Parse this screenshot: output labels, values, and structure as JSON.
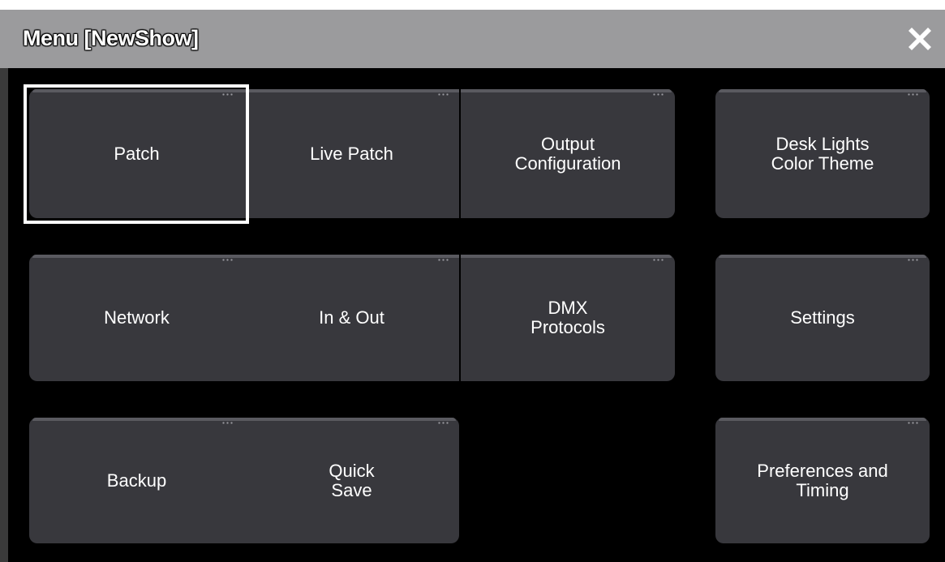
{
  "window": {
    "title": "Menu [NewShow]"
  },
  "tiles": {
    "patch": "Patch",
    "live_patch": "Live Patch",
    "output_configuration": [
      "Output",
      "Configuration"
    ],
    "desk_lights": [
      "Desk Lights",
      "Color Theme"
    ],
    "network": "Network",
    "in_out": "In & Out",
    "dmx_protocols": [
      "DMX",
      "Protocols"
    ],
    "settings": "Settings",
    "backup": "Backup",
    "quick_save": [
      "Quick",
      "Save"
    ],
    "preferences": [
      "Preferences and",
      "Timing"
    ]
  },
  "selected_tile": "Patch",
  "colors": {
    "title_bar": "#9b9b9d",
    "tile_bg": "#38383d",
    "focus_border": "#ffffff",
    "background": "#000000"
  }
}
